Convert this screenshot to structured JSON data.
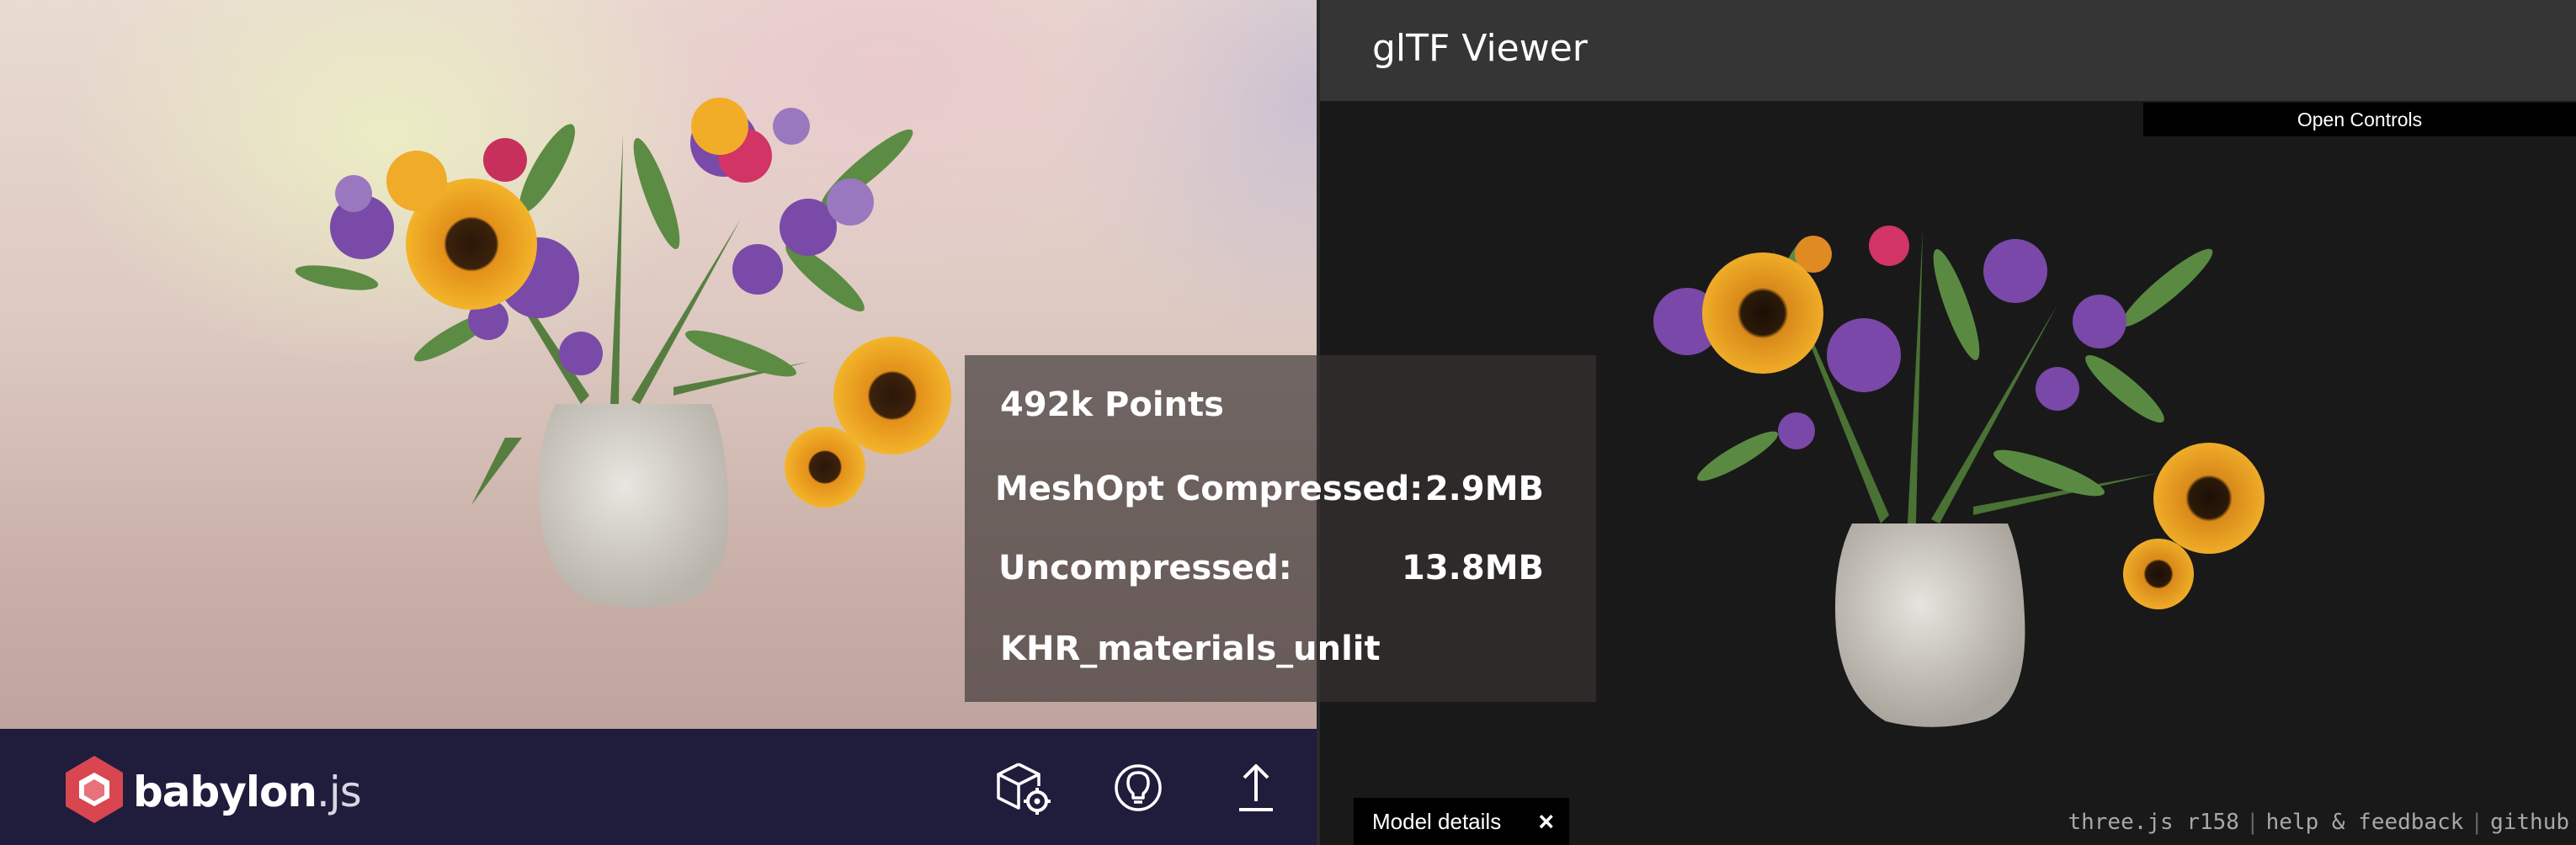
{
  "babylon": {
    "logo_text_bold": "babylon",
    "logo_text_light": ".js",
    "buttons": [
      {
        "icon": "cube-settings-icon"
      },
      {
        "icon": "lightbulb-icon"
      },
      {
        "icon": "upload-icon"
      }
    ]
  },
  "info": {
    "points": "492k Points",
    "meshopt_label": "MeshOpt Compressed:",
    "meshopt_value": "2.9MB",
    "uncompressed_label": "Uncompressed:",
    "uncompressed_value": "13.8MB",
    "extension": "KHR_materials_unlit"
  },
  "gltf": {
    "title": "glTF Viewer",
    "open_controls": "Open Controls",
    "model_details": "Model details",
    "close_symbol": "×",
    "footer_links": [
      "three.js r158",
      "help & feedback",
      "github"
    ],
    "footer_separator": "|"
  },
  "colors": {
    "babylon_footer": "#201c3c",
    "logo_red": "#d9464f",
    "gltf_header": "#353535",
    "gltf_background": "#191919"
  }
}
